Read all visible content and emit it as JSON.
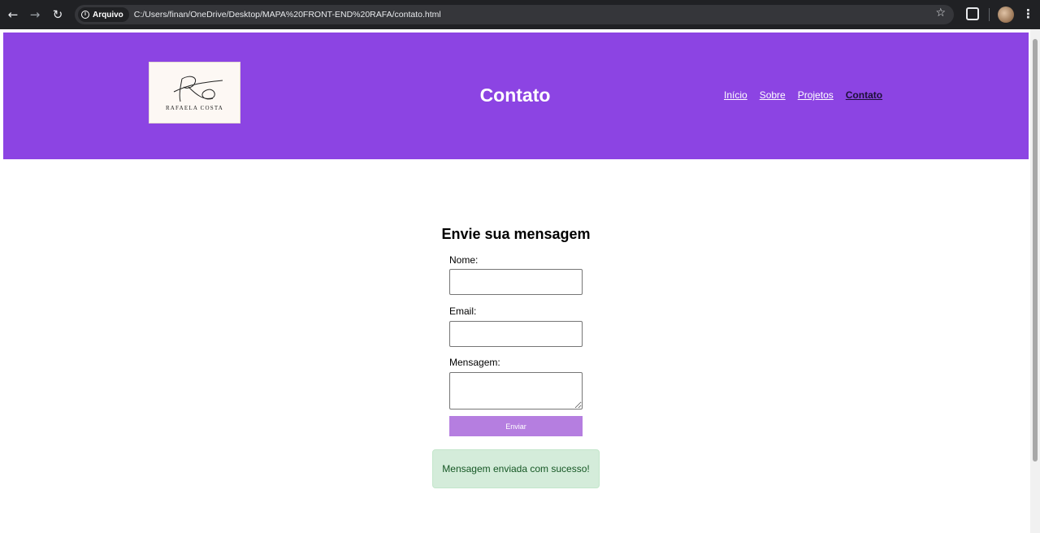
{
  "browser": {
    "security_chip": "Arquivo",
    "address": "C:/Users/finan/OneDrive/Desktop/MAPA%20FRONT-END%20RAFA/contato.html"
  },
  "header": {
    "logo_text": "RAFAELA COSTA",
    "title": "Contato",
    "nav": [
      "Início",
      "Sobre",
      "Projetos",
      "Contato"
    ],
    "active_nav": "Contato"
  },
  "form": {
    "heading": "Envie sua mensagem",
    "name_label": "Nome:",
    "name_value": "",
    "email_label": "Email:",
    "email_value": "",
    "message_label": "Mensagem:",
    "message_value": "",
    "submit_label": "Enviar"
  },
  "success_message": "Mensagem enviada com sucesso!",
  "colors": {
    "header_bg": "#8c44e3",
    "button_bg": "#b57ee0",
    "success_bg": "#d4ecda",
    "success_text": "#155724"
  }
}
